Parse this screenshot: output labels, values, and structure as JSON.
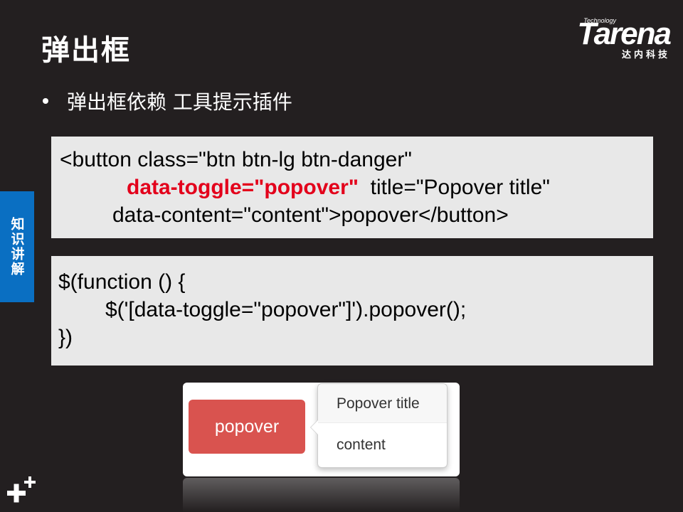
{
  "slide": {
    "title": "弹出框",
    "bullet": "弹出框依赖 工具提示插件",
    "side_tab": "知识讲解"
  },
  "logo": {
    "tagline": "Technology",
    "brand": "Tarena",
    "cn_name": "达内科技"
  },
  "code_html": {
    "line1": "<button class=\"btn btn-lg btn-danger\"",
    "line2_red": "data-toggle=\"popover\"",
    "line2_rest": "  title=\"Popover title\"",
    "line3": "data-content=\"content\">popover</button>"
  },
  "code_js": {
    "line1": "$(function () {",
    "line2": "$('[data-toggle=\"popover\"]').popover();",
    "line3": "})"
  },
  "demo": {
    "button_label": "popover",
    "popover_title": "Popover title",
    "popover_content": "content"
  },
  "colors": {
    "background": "#231f20",
    "code_bg": "#e8e8e8",
    "highlight_red": "#e3001b",
    "side_tab_blue": "#0a6fc2",
    "danger_button": "#d9534f"
  },
  "icons": {
    "corner": "plus-icon"
  }
}
